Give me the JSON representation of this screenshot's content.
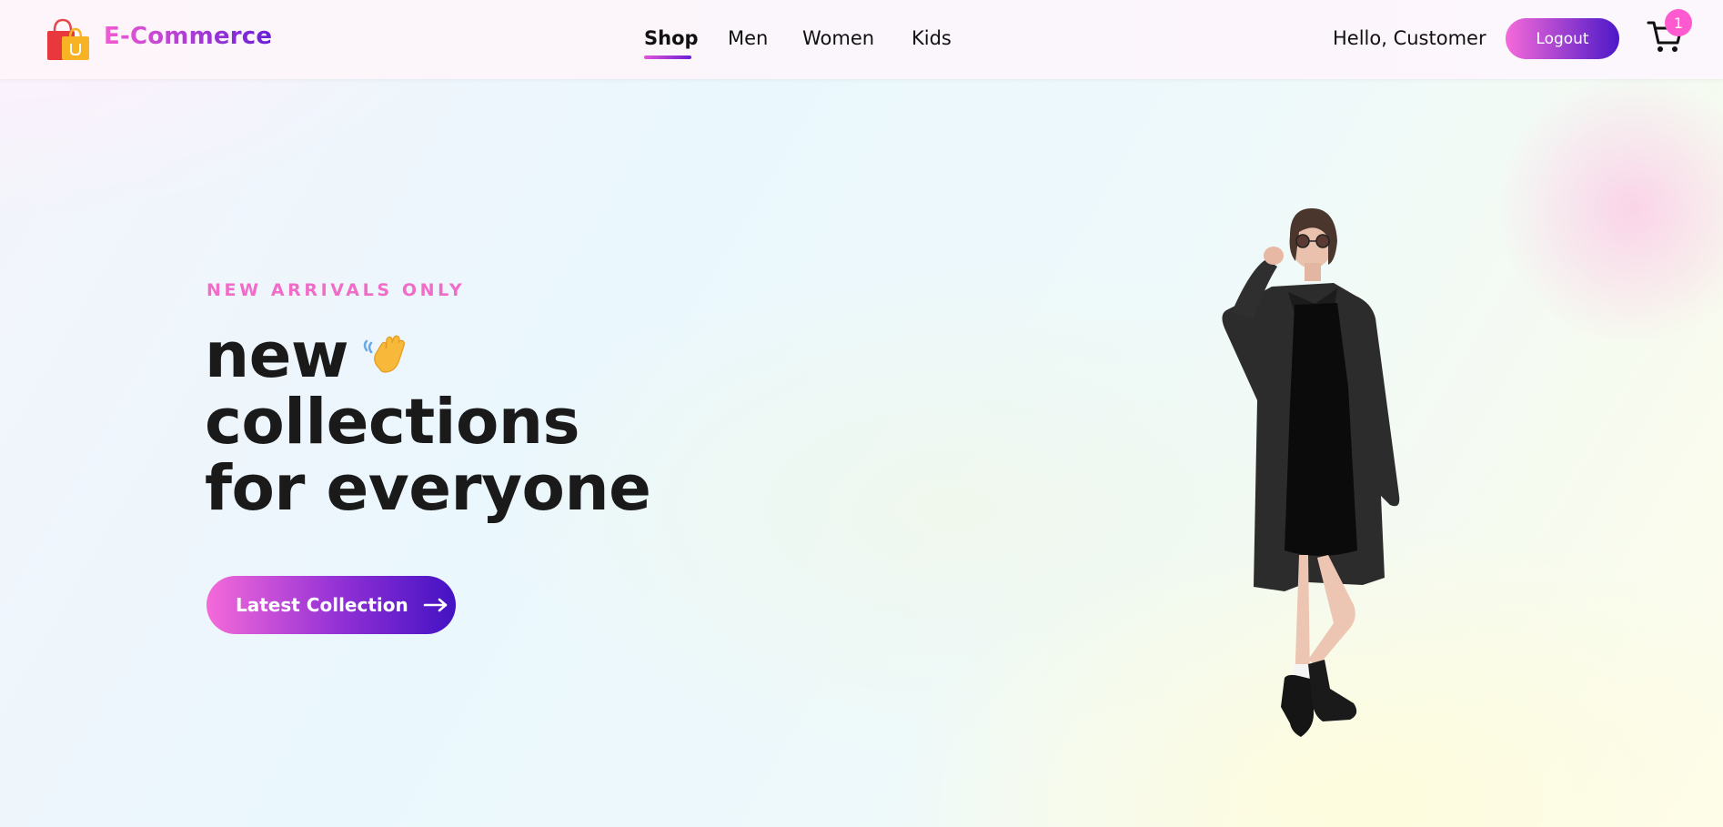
{
  "brand": {
    "logo_icon": "shopping-bag-icon",
    "name": "E-Commerce"
  },
  "nav": {
    "items": [
      {
        "label": "Shop",
        "active": true
      },
      {
        "label": "Men",
        "active": false
      },
      {
        "label": "Women",
        "active": false
      },
      {
        "label": "Kids",
        "active": false
      }
    ]
  },
  "user": {
    "greeting": "Hello, Customer",
    "logout_label": "Logout"
  },
  "cart": {
    "icon": "cart-icon",
    "count": "1"
  },
  "hero": {
    "eyebrow": "NEW ARRIVALS ONLY",
    "headline_line1": "new",
    "headline_line2": "collections",
    "headline_line3": "for everyone",
    "wave_icon": "waving-hand-icon",
    "cta_label": "Latest Collection",
    "cta_icon": "arrow-right-icon",
    "image": "model-woman-black-coat"
  },
  "colors": {
    "accent_start": "#f56ad9",
    "accent_end": "#4312c3",
    "eyebrow": "#f06cc8",
    "badge": "#ff5ad0",
    "text": "#1a1a1a"
  }
}
